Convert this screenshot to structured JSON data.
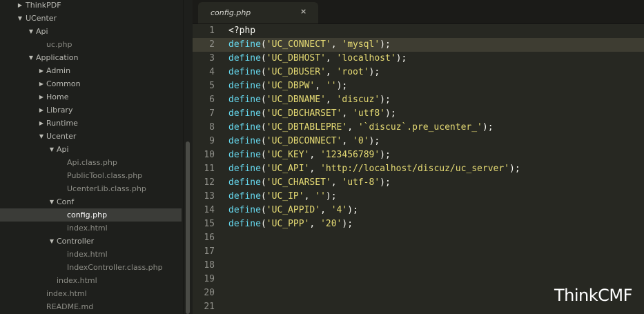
{
  "sidebar": {
    "tree": [
      {
        "label": "ThinkPDF",
        "depth": 1,
        "kind": "folder",
        "expanded": false
      },
      {
        "label": "UCenter",
        "depth": 1,
        "kind": "folder",
        "expanded": true
      },
      {
        "label": "Api",
        "depth": 2,
        "kind": "folder",
        "expanded": true
      },
      {
        "label": "uc.php",
        "depth": 3,
        "kind": "file"
      },
      {
        "label": "Application",
        "depth": 2,
        "kind": "folder",
        "expanded": true
      },
      {
        "label": "Admin",
        "depth": 3,
        "kind": "folder",
        "expanded": false
      },
      {
        "label": "Common",
        "depth": 3,
        "kind": "folder",
        "expanded": false
      },
      {
        "label": "Home",
        "depth": 3,
        "kind": "folder",
        "expanded": false
      },
      {
        "label": "Library",
        "depth": 3,
        "kind": "folder",
        "expanded": false
      },
      {
        "label": "Runtime",
        "depth": 3,
        "kind": "folder",
        "expanded": false
      },
      {
        "label": "Ucenter",
        "depth": 3,
        "kind": "folder",
        "expanded": true
      },
      {
        "label": "Api",
        "depth": 4,
        "kind": "folder",
        "expanded": true
      },
      {
        "label": "Api.class.php",
        "depth": 5,
        "kind": "file"
      },
      {
        "label": "PublicTool.class.php",
        "depth": 5,
        "kind": "file"
      },
      {
        "label": "UcenterLib.class.php",
        "depth": 5,
        "kind": "file"
      },
      {
        "label": "Conf",
        "depth": 4,
        "kind": "folder",
        "expanded": true
      },
      {
        "label": "config.php",
        "depth": 5,
        "kind": "file",
        "selected": true
      },
      {
        "label": "index.html",
        "depth": 5,
        "kind": "file"
      },
      {
        "label": "Controller",
        "depth": 4,
        "kind": "folder",
        "expanded": true
      },
      {
        "label": "index.html",
        "depth": 5,
        "kind": "file"
      },
      {
        "label": "IndexController.class.php",
        "depth": 5,
        "kind": "file"
      },
      {
        "label": "index.html",
        "depth": 4,
        "kind": "file"
      },
      {
        "label": "index.html",
        "depth": 3,
        "kind": "file"
      },
      {
        "label": "README.md",
        "depth": 3,
        "kind": "file"
      }
    ]
  },
  "tab": {
    "title": "config.php",
    "close_glyph": "×"
  },
  "editor": {
    "current_line": 2,
    "lines": [
      {
        "num": "1",
        "tokens": [
          {
            "t": "<?php",
            "k": "punc"
          }
        ]
      },
      {
        "num": "2",
        "tokens": [
          {
            "t": "define",
            "k": "fn"
          },
          {
            "t": "(",
            "k": "punc"
          },
          {
            "t": "'UC_CONNECT'",
            "k": "str"
          },
          {
            "t": ", ",
            "k": "punc"
          },
          {
            "t": "'mysql'",
            "k": "str"
          },
          {
            "t": ");",
            "k": "punc"
          }
        ]
      },
      {
        "num": "3",
        "tokens": [
          {
            "t": "define",
            "k": "fn"
          },
          {
            "t": "(",
            "k": "punc"
          },
          {
            "t": "'UC_DBHOST'",
            "k": "str"
          },
          {
            "t": ", ",
            "k": "punc"
          },
          {
            "t": "'localhost'",
            "k": "str"
          },
          {
            "t": ");",
            "k": "punc"
          }
        ]
      },
      {
        "num": "4",
        "tokens": [
          {
            "t": "define",
            "k": "fn"
          },
          {
            "t": "(",
            "k": "punc"
          },
          {
            "t": "'UC_DBUSER'",
            "k": "str"
          },
          {
            "t": ", ",
            "k": "punc"
          },
          {
            "t": "'root'",
            "k": "str"
          },
          {
            "t": ");",
            "k": "punc"
          }
        ]
      },
      {
        "num": "5",
        "tokens": [
          {
            "t": "define",
            "k": "fn"
          },
          {
            "t": "(",
            "k": "punc"
          },
          {
            "t": "'UC_DBPW'",
            "k": "str"
          },
          {
            "t": ", ",
            "k": "punc"
          },
          {
            "t": "''",
            "k": "str"
          },
          {
            "t": ");",
            "k": "punc"
          }
        ]
      },
      {
        "num": "6",
        "tokens": [
          {
            "t": "define",
            "k": "fn"
          },
          {
            "t": "(",
            "k": "punc"
          },
          {
            "t": "'UC_DBNAME'",
            "k": "str"
          },
          {
            "t": ", ",
            "k": "punc"
          },
          {
            "t": "'discuz'",
            "k": "str"
          },
          {
            "t": ");",
            "k": "punc"
          }
        ]
      },
      {
        "num": "7",
        "tokens": [
          {
            "t": "define",
            "k": "fn"
          },
          {
            "t": "(",
            "k": "punc"
          },
          {
            "t": "'UC_DBCHARSET'",
            "k": "str"
          },
          {
            "t": ", ",
            "k": "punc"
          },
          {
            "t": "'utf8'",
            "k": "str"
          },
          {
            "t": ");",
            "k": "punc"
          }
        ]
      },
      {
        "num": "8",
        "tokens": [
          {
            "t": "define",
            "k": "fn"
          },
          {
            "t": "(",
            "k": "punc"
          },
          {
            "t": "'UC_DBTABLEPRE'",
            "k": "str"
          },
          {
            "t": ", ",
            "k": "punc"
          },
          {
            "t": "'`discuz`.pre_ucenter_'",
            "k": "str"
          },
          {
            "t": ");",
            "k": "punc"
          }
        ]
      },
      {
        "num": "9",
        "tokens": [
          {
            "t": "define",
            "k": "fn"
          },
          {
            "t": "(",
            "k": "punc"
          },
          {
            "t": "'UC_DBCONNECT'",
            "k": "str"
          },
          {
            "t": ", ",
            "k": "punc"
          },
          {
            "t": "'0'",
            "k": "str"
          },
          {
            "t": ");",
            "k": "punc"
          }
        ]
      },
      {
        "num": "10",
        "tokens": [
          {
            "t": "define",
            "k": "fn"
          },
          {
            "t": "(",
            "k": "punc"
          },
          {
            "t": "'UC_KEY'",
            "k": "str"
          },
          {
            "t": ", ",
            "k": "punc"
          },
          {
            "t": "'123456789'",
            "k": "str"
          },
          {
            "t": ");",
            "k": "punc"
          }
        ]
      },
      {
        "num": "11",
        "tokens": [
          {
            "t": "define",
            "k": "fn"
          },
          {
            "t": "(",
            "k": "punc"
          },
          {
            "t": "'UC_API'",
            "k": "str"
          },
          {
            "t": ", ",
            "k": "punc"
          },
          {
            "t": "'http://localhost/discuz/uc_server'",
            "k": "str"
          },
          {
            "t": ");",
            "k": "punc"
          }
        ]
      },
      {
        "num": "12",
        "tokens": [
          {
            "t": "define",
            "k": "fn"
          },
          {
            "t": "(",
            "k": "punc"
          },
          {
            "t": "'UC_CHARSET'",
            "k": "str"
          },
          {
            "t": ", ",
            "k": "punc"
          },
          {
            "t": "'utf-8'",
            "k": "str"
          },
          {
            "t": ");",
            "k": "punc"
          }
        ]
      },
      {
        "num": "13",
        "tokens": [
          {
            "t": "define",
            "k": "fn"
          },
          {
            "t": "(",
            "k": "punc"
          },
          {
            "t": "'UC_IP'",
            "k": "str"
          },
          {
            "t": ", ",
            "k": "punc"
          },
          {
            "t": "''",
            "k": "str"
          },
          {
            "t": ");",
            "k": "punc"
          }
        ]
      },
      {
        "num": "14",
        "tokens": [
          {
            "t": "define",
            "k": "fn"
          },
          {
            "t": "(",
            "k": "punc"
          },
          {
            "t": "'UC_APPID'",
            "k": "str"
          },
          {
            "t": ", ",
            "k": "punc"
          },
          {
            "t": "'4'",
            "k": "str"
          },
          {
            "t": ");",
            "k": "punc"
          }
        ]
      },
      {
        "num": "15",
        "tokens": [
          {
            "t": "define",
            "k": "fn"
          },
          {
            "t": "(",
            "k": "punc"
          },
          {
            "t": "'UC_PPP'",
            "k": "str"
          },
          {
            "t": ", ",
            "k": "punc"
          },
          {
            "t": "'20'",
            "k": "str"
          },
          {
            "t": ");",
            "k": "punc"
          }
        ]
      },
      {
        "num": "16",
        "tokens": []
      },
      {
        "num": "17",
        "tokens": []
      },
      {
        "num": "18",
        "tokens": []
      },
      {
        "num": "19",
        "tokens": []
      },
      {
        "num": "20",
        "tokens": []
      },
      {
        "num": "21",
        "tokens": []
      }
    ]
  },
  "watermark": "ThinkCMF",
  "colors": {
    "background": "#272822",
    "sidebar": "#1e1f1c",
    "keyword": "#66d9ef",
    "string": "#e6db74",
    "text": "#f8f8f2",
    "line_highlight": "#3e3d32"
  }
}
